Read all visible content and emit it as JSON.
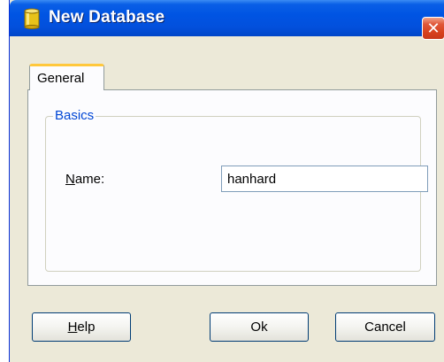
{
  "window": {
    "title": "New Database",
    "icon": "database-icon",
    "close_glyph": "✕"
  },
  "tabs": [
    {
      "label": "General",
      "selected": true
    }
  ],
  "basics": {
    "legend": "Basics",
    "name_label_mnemonic": "N",
    "name_label_rest": "ame:",
    "name_value": "hanhard"
  },
  "buttons": {
    "help_mnemonic": "H",
    "help_rest": "elp",
    "ok_label": "Ok",
    "cancel_label": "Cancel"
  },
  "colors": {
    "titlebar": "#0054e3",
    "dialog_bg": "#ece9d8",
    "close_button": "#d7401c",
    "tab_highlight": "#ffc83c",
    "group_legend": "#0046d5"
  }
}
